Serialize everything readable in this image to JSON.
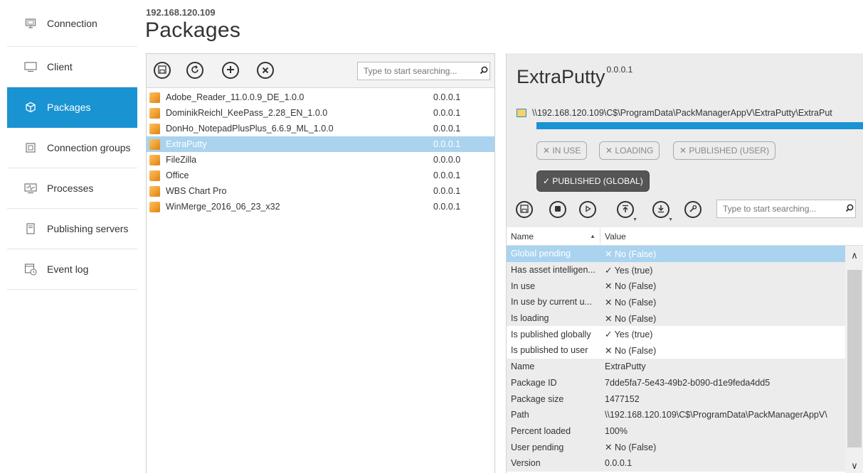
{
  "sidebar": {
    "items": [
      {
        "label": "Connection",
        "icon": "monitor-icon"
      },
      {
        "label": "Client",
        "icon": "screen-icon"
      },
      {
        "label": "Packages",
        "icon": "cube-icon"
      },
      {
        "label": "Connection groups",
        "icon": "groups-icon"
      },
      {
        "label": "Processes",
        "icon": "pulse-icon"
      },
      {
        "label": "Publishing servers",
        "icon": "server-icon"
      },
      {
        "label": "Event log",
        "icon": "event-log-icon"
      }
    ],
    "active_index": 2
  },
  "header": {
    "host": "192.168.120.109",
    "title": "Packages"
  },
  "packages": {
    "search_placeholder": "Type to start searching...",
    "items": [
      {
        "name": "Adobe_Reader_11.0.0.9_DE_1.0.0",
        "version": "0.0.0.1"
      },
      {
        "name": "DominikReichl_KeePass_2.28_EN_1.0.0",
        "version": "0.0.0.1"
      },
      {
        "name": "DonHo_NotepadPlusPlus_6.6.9_ML_1.0.0",
        "version": "0.0.0.1"
      },
      {
        "name": "ExtraPutty",
        "version": "0.0.0.1"
      },
      {
        "name": "FileZilla",
        "version": "0.0.0.0"
      },
      {
        "name": "Office",
        "version": "0.0.0.1"
      },
      {
        "name": "WBS Chart Pro",
        "version": "0.0.0.1"
      },
      {
        "name": "WinMerge_2016_06_23_x32",
        "version": "0.0.0.1"
      }
    ],
    "selected_index": 3
  },
  "detail": {
    "title": "ExtraPutty",
    "version": "0.0.0.1",
    "path": "\\\\192.168.120.109\\C$\\ProgramData\\PackManagerAppV\\ExtraPutty\\ExtraPut",
    "progress_percent": 100,
    "status": {
      "in_use": "✕ IN USE",
      "loading": "✕ LOADING",
      "published_user": "✕ PUBLISHED (USER)",
      "published_global": "✓ PUBLISHED (GLOBAL)"
    },
    "search_placeholder": "Type to start searching...",
    "grid": {
      "col_name": "Name",
      "col_value": "Value",
      "rows": [
        {
          "name": "Global pending",
          "value": "✕ No (False)"
        },
        {
          "name": "Has asset intelligen...",
          "value": "✓ Yes (true)"
        },
        {
          "name": "In use",
          "value": "✕ No (False)"
        },
        {
          "name": "In use by current u...",
          "value": "✕ No (False)"
        },
        {
          "name": "Is loading",
          "value": "✕ No (False)"
        },
        {
          "name": "Is published globally",
          "value": "✓ Yes (true)"
        },
        {
          "name": "Is published to user",
          "value": "✕ No (False)"
        },
        {
          "name": "Name",
          "value": "ExtraPutty"
        },
        {
          "name": "Package ID",
          "value": "7dde5fa7-5e43-49b2-b090-d1e9feda4dd5"
        },
        {
          "name": "Package size",
          "value": "1477152"
        },
        {
          "name": "Path",
          "value": "\\\\192.168.120.109\\C$\\ProgramData\\PackManagerAppV\\"
        },
        {
          "name": "Percent loaded",
          "value": "100%"
        },
        {
          "name": "User pending",
          "value": "✕ No (False)"
        },
        {
          "name": "Version",
          "value": "0.0.0.1"
        }
      ]
    }
  },
  "colors": {
    "accent": "#1a93d3",
    "selection": "#a9d3ef"
  }
}
